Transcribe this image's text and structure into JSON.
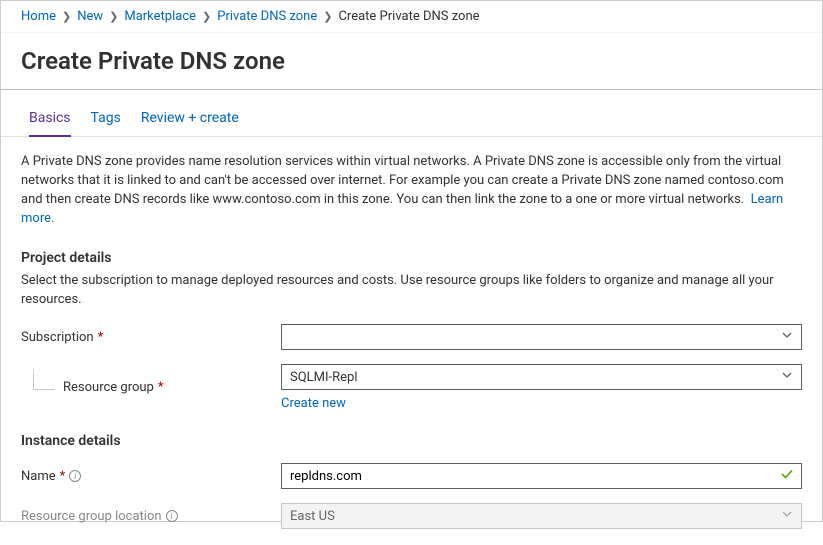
{
  "breadcrumb": {
    "items": [
      "Home",
      "New",
      "Marketplace",
      "Private DNS zone"
    ],
    "current": "Create Private DNS zone"
  },
  "page_title": "Create Private DNS zone",
  "tabs": {
    "basics": "Basics",
    "tags": "Tags",
    "review": "Review + create"
  },
  "description": "A Private DNS zone provides name resolution services within virtual networks. A Private DNS zone is accessible only from the virtual networks that it is linked to and can't be accessed over internet. For example you can create a Private DNS zone named contoso.com and then create DNS records like www.contoso.com in this zone. You can then link the zone to a one or more virtual networks.",
  "learn_more": "Learn more.",
  "project": {
    "heading": "Project details",
    "sub": "Select the subscription to manage deployed resources and costs. Use resource groups like folders to organize and manage all your resources.",
    "subscription_label": "Subscription",
    "subscription_value": "",
    "resource_group_label": "Resource group",
    "resource_group_value": "SQLMI-Repl",
    "create_new": "Create new"
  },
  "instance": {
    "heading": "Instance details",
    "name_label": "Name",
    "name_value": "repldns.com",
    "location_label": "Resource group location",
    "location_value": "East US"
  }
}
